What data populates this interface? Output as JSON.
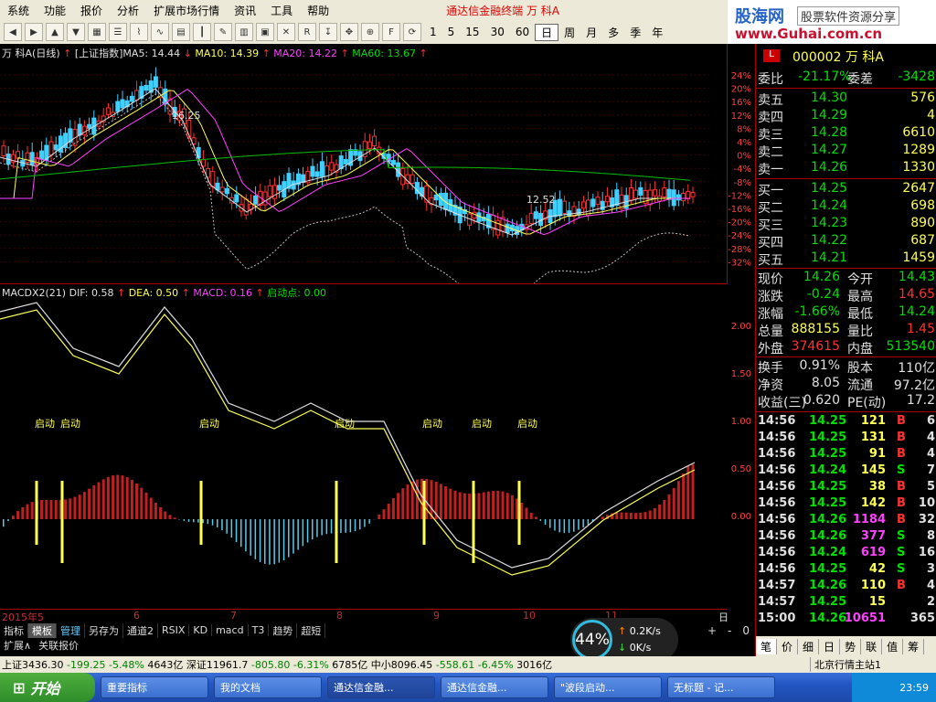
{
  "menu": {
    "items": [
      "系统",
      "功能",
      "报价",
      "分析",
      "扩展市场行情",
      "资讯",
      "工具",
      "帮助"
    ],
    "title": "通达信金融终端   万   科A"
  },
  "logo": {
    "line1": "股海网",
    "line2": "股票软件资源分享",
    "line3": "www.Guhai.com.cn"
  },
  "toolbar": {
    "periods": [
      "1",
      "5",
      "15",
      "30",
      "60",
      "日",
      "周",
      "月",
      "多",
      "季",
      "年"
    ],
    "active_period": "日"
  },
  "chart_head": {
    "name": "万  科A(日线)",
    "index_label": "[上证指数]",
    "ma5": "MA5: 14.44",
    "ma10": "MA10: 14.39",
    "ma20": "MA20: 14.22",
    "ma60": "MA60: 13.67",
    "high_label": "16.25",
    "low_label": "12.52"
  },
  "main_yaxis": [
    "24%",
    "20%",
    "16%",
    "12%",
    "8%",
    "4%",
    "0%",
    "-4%",
    "-8%",
    "-12%",
    "-16%",
    "-20%",
    "-24%",
    "-28%",
    "-32%"
  ],
  "macd_head": {
    "name": "MACDX2(21)",
    "dif": "DIF: 0.58",
    "dea": "DEA: 0.50",
    "macd": "MACD: 0.16",
    "qidong": "启动点: 0.00"
  },
  "macd_yaxis": [
    "2.00",
    "1.50",
    "1.00",
    "0.50",
    "0.00"
  ],
  "qidong_label": "启动",
  "xaxis": {
    "year": "2015年5",
    "months": [
      "6",
      "7",
      "8",
      "9",
      "10",
      "11"
    ],
    "period": "日线"
  },
  "bottom_tabs": [
    "指标",
    "模板",
    "管理",
    "另存为",
    "通道2",
    "RSIX",
    "KD",
    "macd",
    "T3",
    "趋势",
    "超短"
  ],
  "active_tab": "模板",
  "ext_bar": {
    "ext": "扩展∧",
    "link": "关联报价"
  },
  "quote": {
    "code": "000002 万  科A",
    "weibi_label": "委比",
    "weibi": "-21.17%",
    "weicha_label": "委差",
    "weicha": "-3428",
    "sell": [
      {
        "label": "卖五",
        "price": "14.30",
        "vol": "576"
      },
      {
        "label": "卖四",
        "price": "14.29",
        "vol": "4"
      },
      {
        "label": "卖三",
        "price": "14.28",
        "vol": "6610"
      },
      {
        "label": "卖二",
        "price": "14.27",
        "vol": "1289"
      },
      {
        "label": "卖一",
        "price": "14.26",
        "vol": "1330"
      }
    ],
    "buy": [
      {
        "label": "买一",
        "price": "14.25",
        "vol": "2647"
      },
      {
        "label": "买二",
        "price": "14.24",
        "vol": "698"
      },
      {
        "label": "买三",
        "price": "14.23",
        "vol": "890"
      },
      {
        "label": "买四",
        "price": "14.22",
        "vol": "687"
      },
      {
        "label": "买五",
        "price": "14.21",
        "vol": "1459"
      }
    ],
    "stats": [
      {
        "l1": "现价",
        "v1": "14.26",
        "c1": "grn",
        "l2": "今开",
        "v2": "14.43",
        "c2": "grn"
      },
      {
        "l1": "涨跌",
        "v1": "-0.24",
        "c1": "grn",
        "l2": "最高",
        "v2": "14.65",
        "c2": "red"
      },
      {
        "l1": "涨幅",
        "v1": "-1.66%",
        "c1": "grn",
        "l2": "最低",
        "v2": "14.24",
        "c2": "grn"
      },
      {
        "l1": "总量",
        "v1": "888155",
        "c1": "yel",
        "l2": "量比",
        "v2": "1.45",
        "c2": "red"
      },
      {
        "l1": "外盘",
        "v1": "374615",
        "c1": "red",
        "l2": "内盘",
        "v2": "513540",
        "c2": "grn"
      }
    ],
    "stats2": [
      {
        "l1": "换手",
        "v1": "0.91%",
        "l2": "股本",
        "v2": "110亿"
      },
      {
        "l1": "净资",
        "v1": "8.05",
        "l2": "流通",
        "v2": "97.2亿"
      },
      {
        "l1": "收益(三)",
        "v1": "0.620",
        "l2": "PE(动)",
        "v2": "17.2"
      }
    ],
    "ticks": [
      {
        "t": "14:56",
        "p": "14.25",
        "v": "121",
        "d": "B",
        "n": "6"
      },
      {
        "t": "14:56",
        "p": "14.25",
        "v": "131",
        "d": "B",
        "n": "4"
      },
      {
        "t": "14:56",
        "p": "14.25",
        "v": "91",
        "d": "B",
        "n": "4"
      },
      {
        "t": "14:56",
        "p": "14.24",
        "v": "145",
        "d": "S",
        "n": "7"
      },
      {
        "t": "14:56",
        "p": "14.25",
        "v": "38",
        "d": "B",
        "n": "5"
      },
      {
        "t": "14:56",
        "p": "14.25",
        "v": "142",
        "d": "B",
        "n": "10"
      },
      {
        "t": "14:56",
        "p": "14.26",
        "v": "1184",
        "d": "B",
        "n": "32"
      },
      {
        "t": "14:56",
        "p": "14.26",
        "v": "377",
        "d": "S",
        "n": "8"
      },
      {
        "t": "14:56",
        "p": "14.24",
        "v": "619",
        "d": "S",
        "n": "16"
      },
      {
        "t": "14:56",
        "p": "14.25",
        "v": "42",
        "d": "S",
        "n": "3"
      },
      {
        "t": "14:57",
        "p": "14.26",
        "v": "110",
        "d": "B",
        "n": "4"
      },
      {
        "t": "14:57",
        "p": "14.25",
        "v": "15",
        "d": "",
        "n": "2"
      },
      {
        "t": "15:00",
        "p": "14.26",
        "v": "10651",
        "d": "",
        "n": "365"
      }
    ],
    "tabs": [
      "笔",
      "价",
      "细",
      "日",
      "势",
      "联",
      "值",
      "筹"
    ]
  },
  "statusbar": {
    "sh": "上证3436.30",
    "sh_chg": "-199.25",
    "sh_pct": "-5.48%",
    "sh_amt": "4643亿",
    "sz": "深证11961.7",
    "sz_chg": "-805.80",
    "sz_pct": "-6.31%",
    "sz_amt": "6785亿",
    "zx": "中小8096.45",
    "zx_chg": "-558.61",
    "zx_pct": "-6.45%",
    "zx_amt": "3016亿",
    "server": "北京行情主站1"
  },
  "indicator": {
    "pct": "44%",
    "up": "0.2K/s",
    "down": "0K/s"
  },
  "taskbar": {
    "start": "开始",
    "tasks": [
      "重要指标",
      "我的文档",
      "通达信金融...",
      "通达信金融...",
      "\"波段启动...",
      "无标题 - 记..."
    ],
    "clock": "23:59"
  }
}
